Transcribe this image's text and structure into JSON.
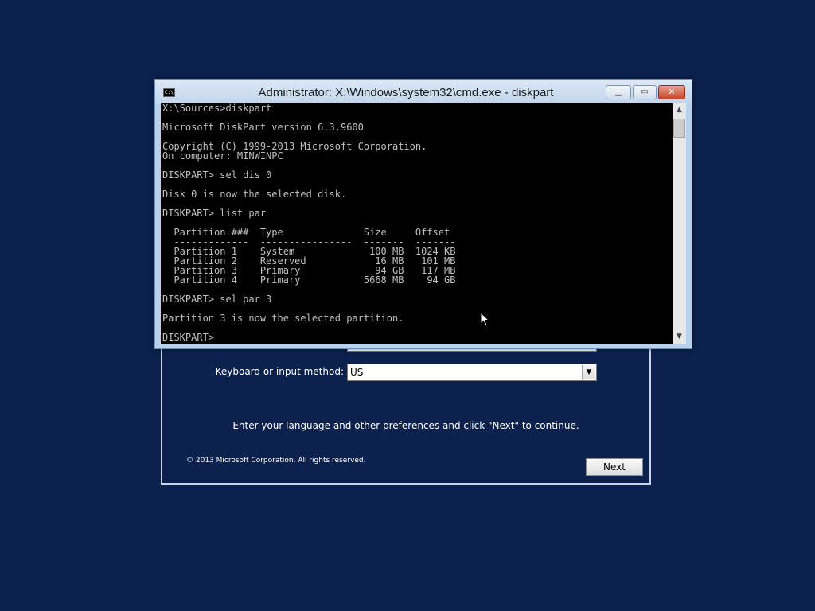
{
  "window": {
    "title": "Administrator: X:\\Windows\\system32\\cmd.exe - diskpart",
    "icon_text": "C:\\",
    "minimize_glyph": "▁",
    "maximize_glyph": "▭",
    "close_glyph": "✕"
  },
  "console": {
    "lines": [
      "X:\\Sources>diskpart",
      "",
      "Microsoft DiskPart version 6.3.9600",
      "",
      "Copyright (C) 1999-2013 Microsoft Corporation.",
      "On computer: MINWINPC",
      "",
      "DISKPART> sel dis 0",
      "",
      "Disk 0 is now the selected disk.",
      "",
      "DISKPART> list par",
      "",
      "  Partition ###  Type              Size     Offset",
      "  -------------  ----------------  -------  -------",
      "  Partition 1    System             100 MB  1024 KB",
      "  Partition 2    Reserved            16 MB   101 MB",
      "  Partition 3    Primary             94 GB   117 MB",
      "  Partition 4    Primary           5668 MB    94 GB",
      "",
      "DISKPART> sel par 3",
      "",
      "Partition 3 is now the selected partition.",
      "",
      "DISKPART>"
    ]
  },
  "scrollbar": {
    "up_glyph": "▲",
    "down_glyph": "▼"
  },
  "setup": {
    "keyboard_label": "Keyboard or input method:",
    "keyboard_value": "US",
    "dropdown_glyph": "▼",
    "instruction": "Enter your language and other preferences and click \"Next\" to continue.",
    "copyright": "© 2013 Microsoft Corporation. All rights reserved.",
    "next_label": "Next"
  },
  "colors": {
    "desktop": "#0c214d",
    "console_bg": "#000000",
    "console_fg": "#c0c0c0"
  }
}
